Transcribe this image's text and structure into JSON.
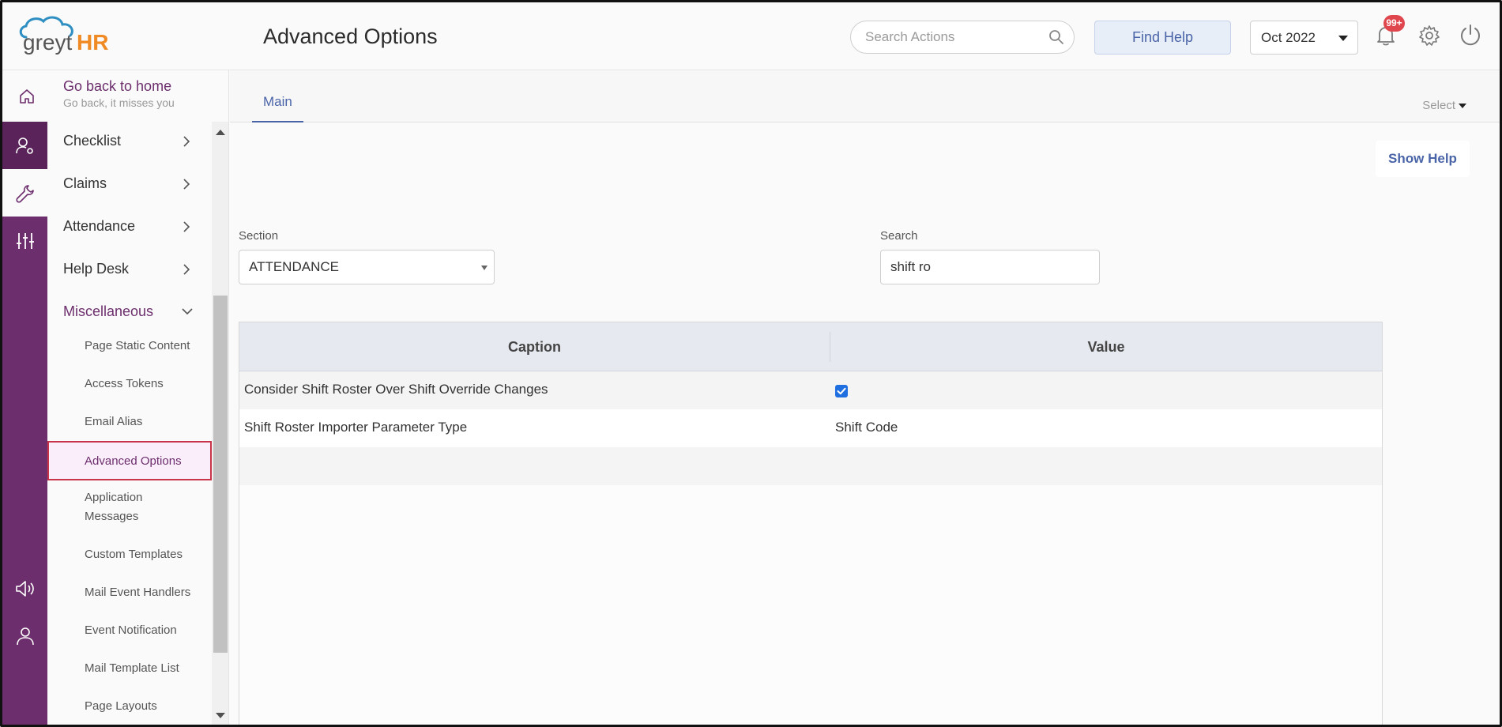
{
  "app": {
    "logo_prefix": "greyt",
    "logo_suffix": "HR",
    "page_title": "Advanced Options"
  },
  "header": {
    "search_placeholder": "Search Actions",
    "find_help_label": "Find Help",
    "period_value": "Oct 2022",
    "notification_badge": "99+"
  },
  "goback": {
    "title": "Go back to home",
    "subtitle": "Go back, it misses you"
  },
  "sidebar": {
    "items": [
      {
        "label": "Checklist"
      },
      {
        "label": "Claims"
      },
      {
        "label": "Attendance"
      },
      {
        "label": "Help Desk"
      },
      {
        "label": "Miscellaneous"
      }
    ],
    "subitems": [
      {
        "label": "Page Static Content"
      },
      {
        "label": "Access Tokens"
      },
      {
        "label": "Email Alias"
      },
      {
        "label": "Advanced Options"
      },
      {
        "label": "Application Messages"
      },
      {
        "label": "Custom Templates"
      },
      {
        "label": "Mail Event Handlers"
      },
      {
        "label": "Event Notification"
      },
      {
        "label": "Mail Template List"
      },
      {
        "label": "Page Layouts"
      }
    ],
    "selected_subitem": "Advanced Options"
  },
  "tabs": {
    "main_label": "Main",
    "select_label": "Select"
  },
  "content": {
    "show_help_label": "Show Help",
    "section_label": "Section",
    "section_value": "ATTENDANCE",
    "search_label": "Search",
    "search_value": "shift ro"
  },
  "table": {
    "headers": [
      "Caption",
      "Value"
    ],
    "rows": [
      {
        "caption": "Consider Shift Roster Over Shift Override Changes",
        "value": "",
        "checked": true
      },
      {
        "caption": "Shift Roster Importer Parameter Type",
        "value": "Shift Code",
        "checked": false
      }
    ]
  },
  "colors": {
    "brand_purple": "#6c2e6c",
    "accent_blue": "#4a64a8",
    "badge_red": "#e0464e",
    "logo_orange": "#f08a24"
  }
}
